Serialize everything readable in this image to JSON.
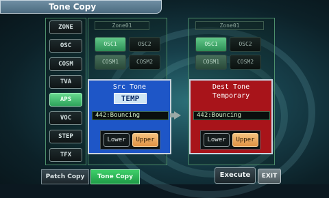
{
  "window": {
    "title": "Tone Copy"
  },
  "sidebar": {
    "items": [
      {
        "label": "ZONE"
      },
      {
        "label": "OSC"
      },
      {
        "label": "COSM"
      },
      {
        "label": "TVA"
      },
      {
        "label": "APS"
      },
      {
        "label": "VOC"
      },
      {
        "label": "STEP"
      },
      {
        "label": "TFX"
      }
    ],
    "active": "APS"
  },
  "source": {
    "zone_label": "Zone01",
    "osc": [
      "OSC1",
      "OSC2"
    ],
    "cosm": [
      "COSM1",
      "COSM2"
    ],
    "heading": "Src Tone",
    "tone_name": "TEMP",
    "patch": "442:Bouncing",
    "lower_label": "Lower",
    "upper_label": "Upper"
  },
  "dest": {
    "zone_label": "Zone01",
    "osc": [
      "OSC1",
      "OSC2"
    ],
    "cosm": [
      "COSM1",
      "COSM2"
    ],
    "heading": "Dest Tone",
    "tone_name": "Temporary",
    "patch": "442:Bouncing",
    "lower_label": "Lower",
    "upper_label": "Upper"
  },
  "bottom": {
    "patch_copy": "Patch Copy",
    "tone_copy": "Tone Copy",
    "execute": "Execute",
    "exit": "EXIT"
  },
  "colors": {
    "src_box": "#1e56c7",
    "dest_box": "#a8141a",
    "active_tab": "#2fbf5a",
    "upper_active": "#f0a95a"
  }
}
